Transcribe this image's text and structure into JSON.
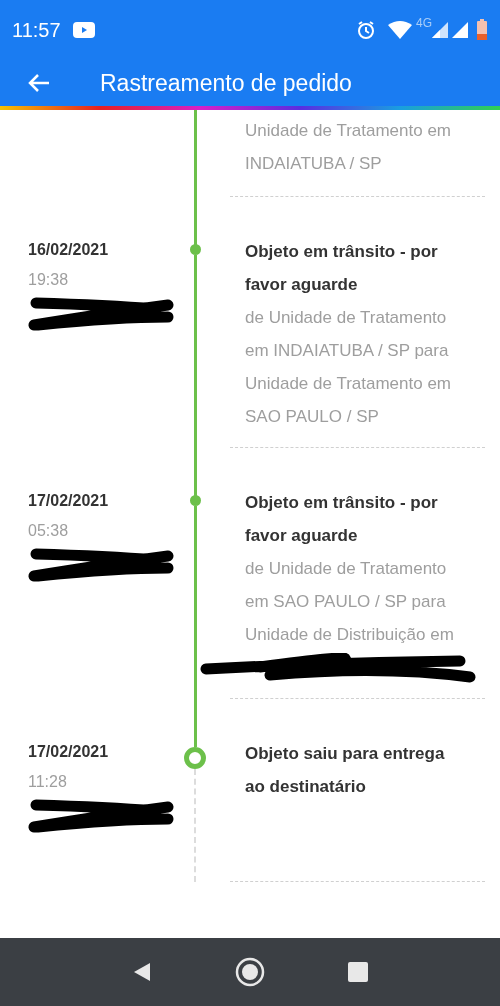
{
  "status_bar": {
    "time": "11:57",
    "network": "4G"
  },
  "header": {
    "title": "Rastreamento de pedido"
  },
  "events": [
    {
      "kind": "partial",
      "detail_lines": [
        "Unidade de Tratamento em",
        "INDAIATUBA / SP"
      ]
    },
    {
      "kind": "transit",
      "date": "16/02/2021",
      "time": "19:38",
      "location_redacted": true,
      "title_lines": [
        "Objeto em trânsito - por",
        "favor aguarde"
      ],
      "detail_lines": [
        "de Unidade de Tratamento",
        "em INDAIATUBA / SP para",
        "Unidade de Tratamento em",
        "SAO PAULO / SP"
      ],
      "detail_redacted": false
    },
    {
      "kind": "transit",
      "date": "17/02/2021",
      "time": "05:38",
      "location_redacted": true,
      "title_lines": [
        "Objeto em trânsito - por",
        "favor aguarde"
      ],
      "detail_lines": [
        "de Unidade de Tratamento",
        "em SAO PAULO / SP para",
        "Unidade de Distribuição em"
      ],
      "detail_redacted": true
    },
    {
      "kind": "current",
      "date": "17/02/2021",
      "time": "11:28",
      "location_redacted": true,
      "title_lines": [
        "Objeto saiu para entrega",
        "ao destinatário"
      ],
      "detail_redacted": false
    }
  ]
}
